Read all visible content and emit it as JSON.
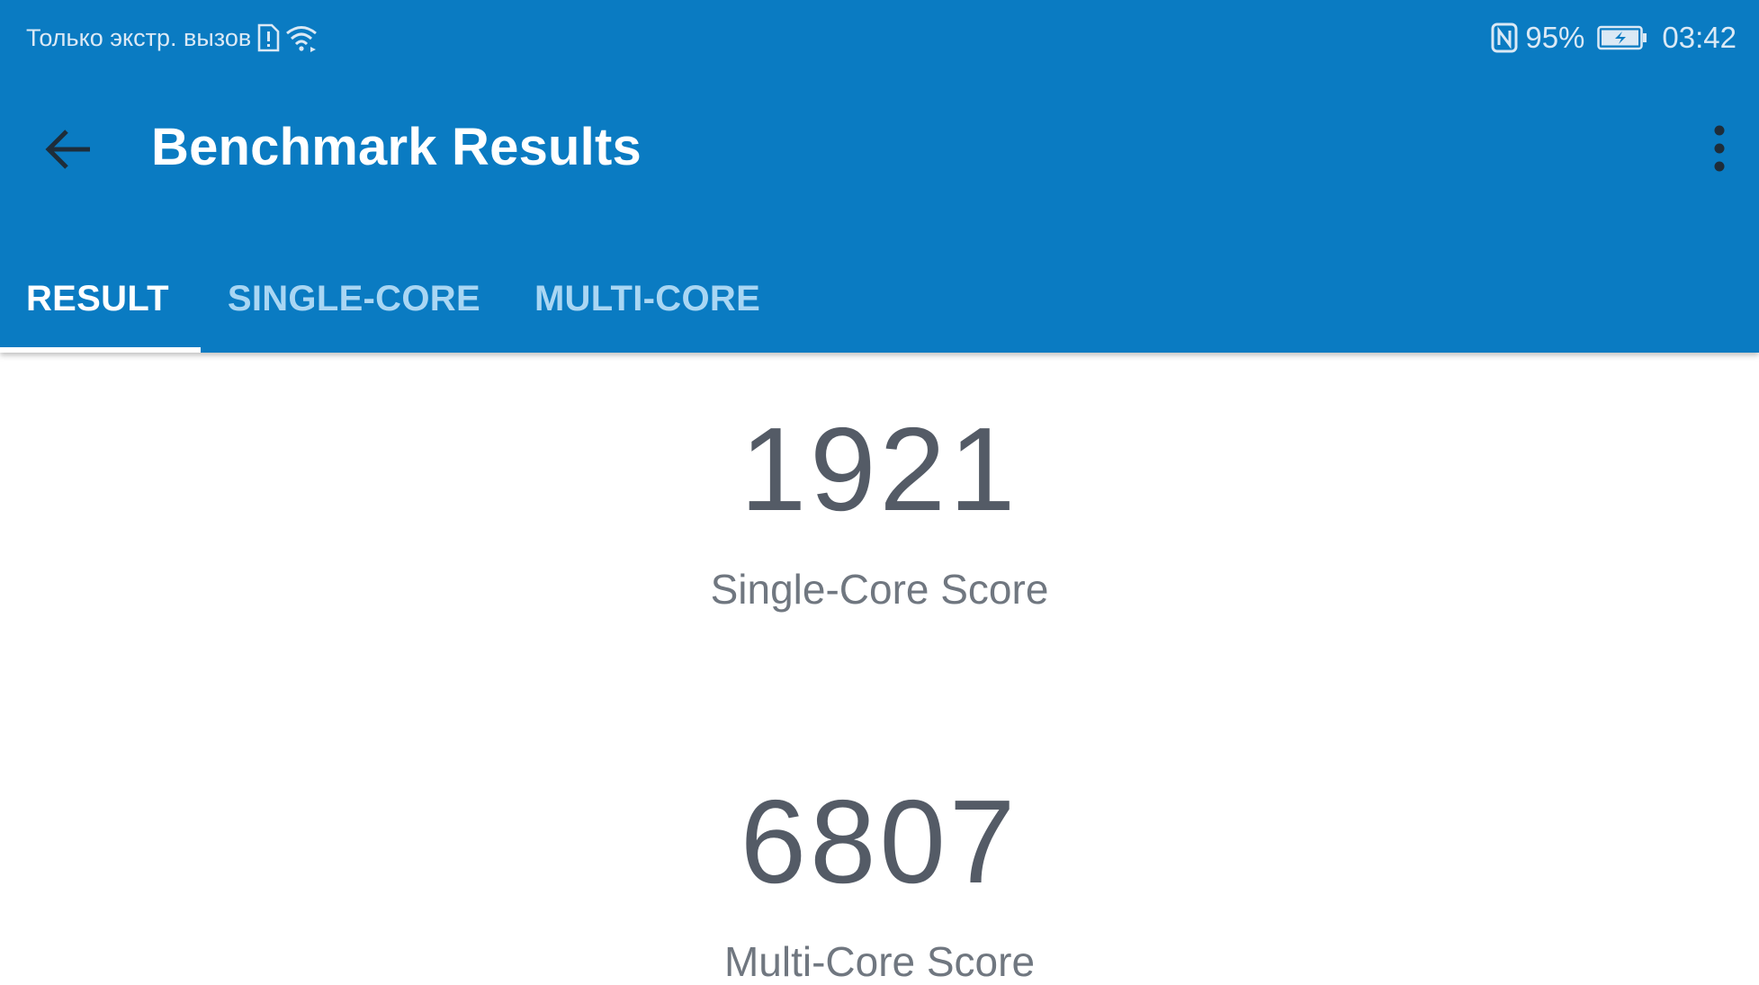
{
  "status_bar": {
    "carrier_text": "Только экстр. вызов",
    "battery_percent": "95%",
    "time": "03:42",
    "icons": [
      "sim-alert-icon",
      "wifi-icon",
      "nfc-icon",
      "battery-charging-icon"
    ]
  },
  "toolbar": {
    "title": "Benchmark Results",
    "back_icon": "arrow-left-icon",
    "menu_icon": "more-vertical-icon"
  },
  "tabs": [
    {
      "label": "RESULT",
      "active": true
    },
    {
      "label": "SINGLE-CORE",
      "active": false
    },
    {
      "label": "MULTI-CORE",
      "active": false
    }
  ],
  "scores": {
    "single_core": {
      "value": "1921",
      "label": "Single-Core Score"
    },
    "multi_core": {
      "value": "6807",
      "label": "Multi-Core Score"
    }
  },
  "colors": {
    "primary": "#0a7bc2",
    "tab_inactive": "#a9d6f3",
    "score_text": "#545b66",
    "label_text": "#707780"
  }
}
